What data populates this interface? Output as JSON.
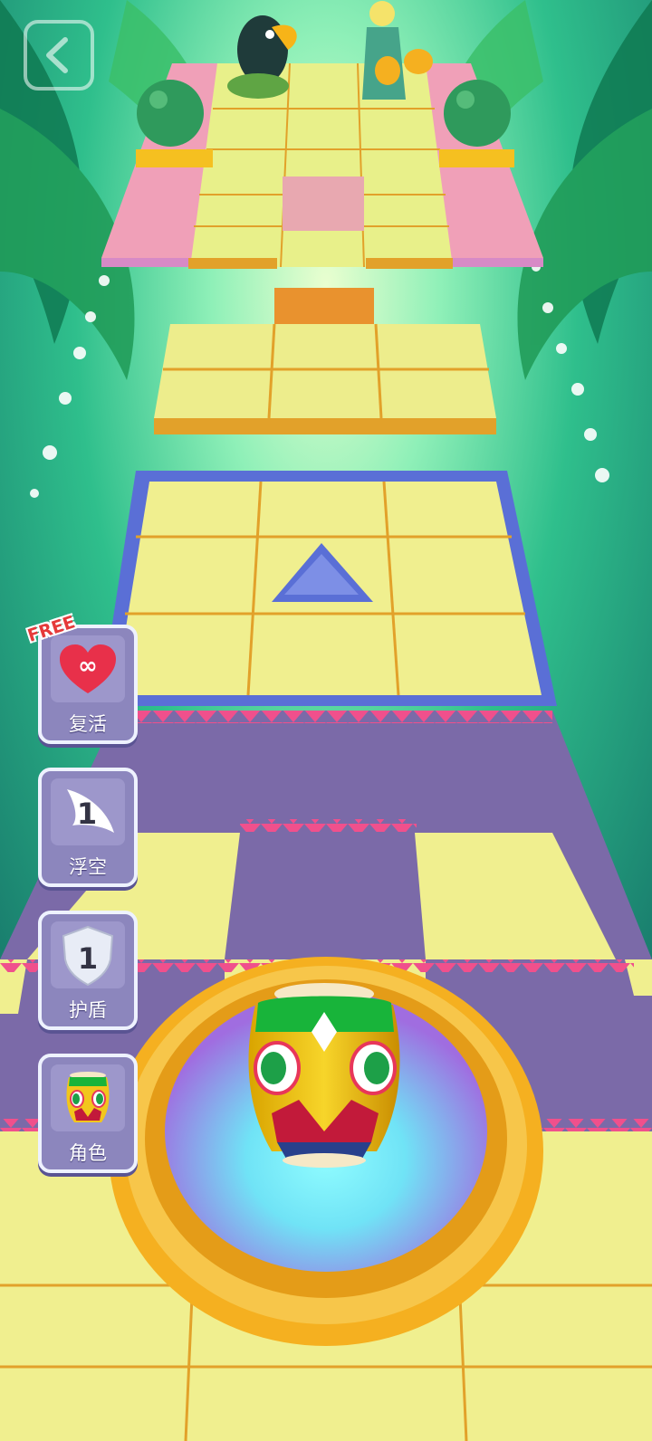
{
  "header": {
    "back_icon": "chevron-left-icon"
  },
  "powerups": [
    {
      "label": "复活",
      "badge": "FREE",
      "icon": "infinity-heart-icon",
      "symbol": "∞"
    },
    {
      "label": "浮空",
      "count": "1",
      "icon": "wing-icon"
    },
    {
      "label": "护盾",
      "count": "1",
      "icon": "shield-icon"
    },
    {
      "label": "角色",
      "icon": "character-drum-icon"
    }
  ],
  "colors": {
    "tile": "#f0ef8f",
    "tile_edge": "#e2a12a",
    "purple_tile": "#7b6aa8",
    "spike": "#f0508c",
    "frame": "#5a6fd6",
    "ring": "#f5b020",
    "glow": "#7af4f8"
  }
}
